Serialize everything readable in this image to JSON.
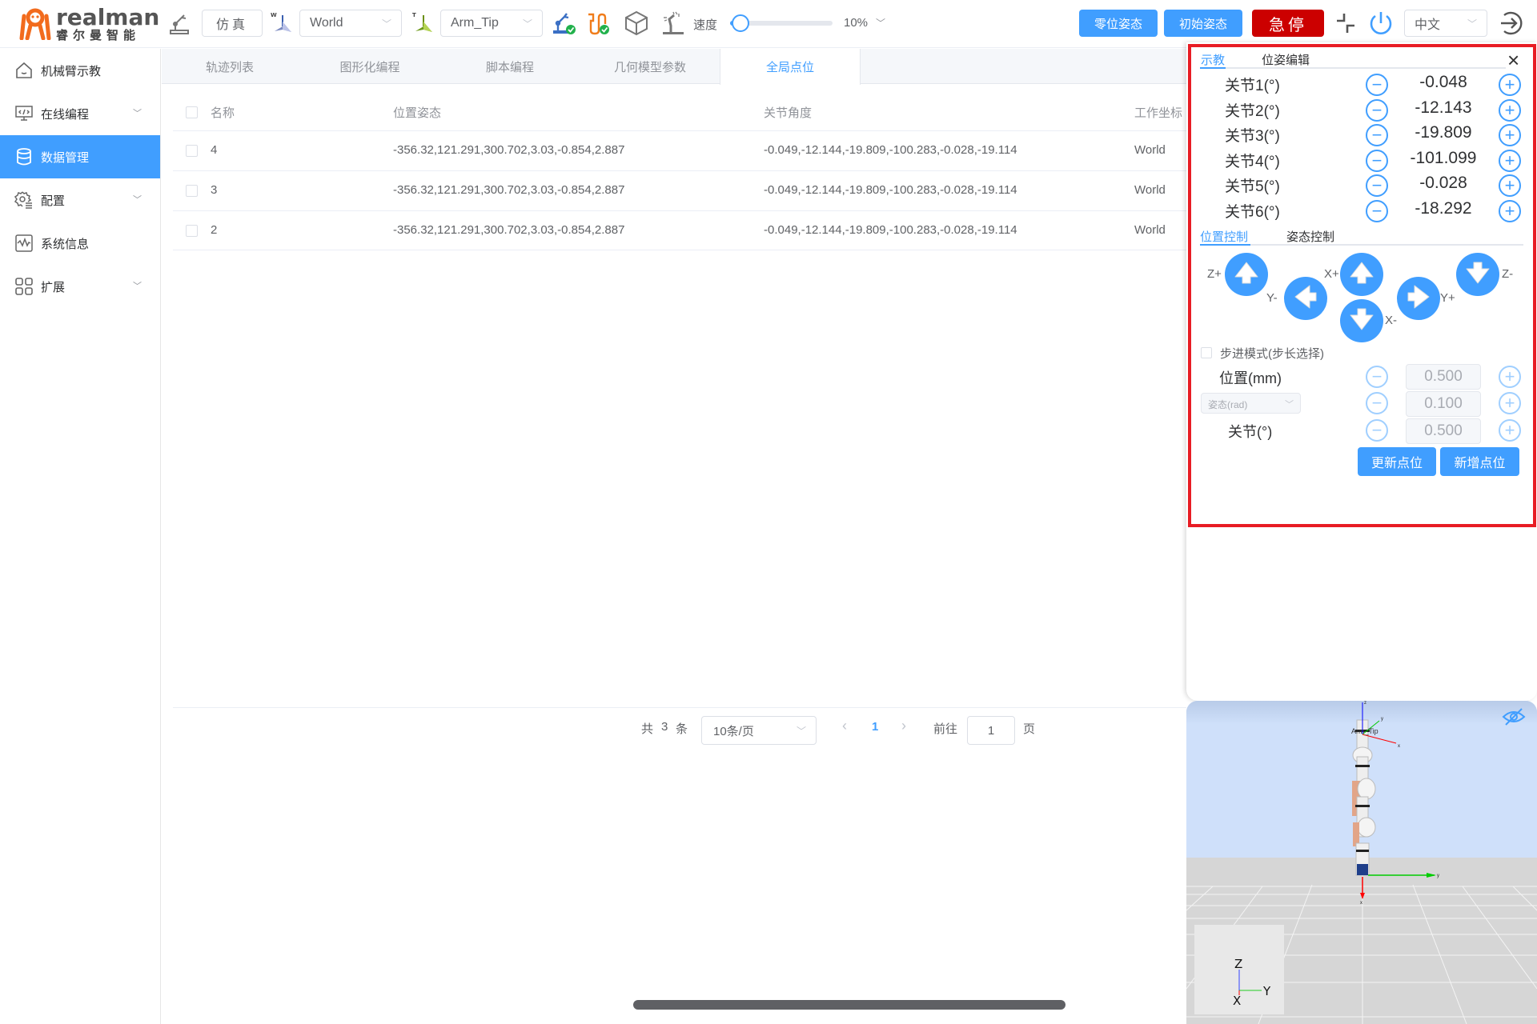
{
  "header": {
    "logo_en": "realman",
    "logo_cn": "睿尔曼智能",
    "mode_button": "仿真",
    "work_frame_prefix": "W",
    "work_frame": "World",
    "tool_frame_prefix": "T",
    "tool_frame": "Arm_Tip",
    "speed_label": "速度",
    "speed_value": "10%",
    "speed_fraction": 0.1,
    "zero_pose_button": "零位姿态",
    "init_pose_button": "初始姿态",
    "estop_button": "急停",
    "language": "中文",
    "colors": {
      "accent": "#409eff",
      "estop": "#cc0000",
      "highlight": "#e81c24"
    }
  },
  "sidebar": {
    "items": [
      {
        "label": "机械臂示教",
        "icon": "home-icon",
        "expandable": false,
        "active": false
      },
      {
        "label": "在线编程",
        "icon": "code-monitor-icon",
        "expandable": true,
        "active": false
      },
      {
        "label": "数据管理",
        "icon": "database-icon",
        "expandable": false,
        "active": true
      },
      {
        "label": "配置",
        "icon": "gear-icon",
        "expandable": true,
        "active": false
      },
      {
        "label": "系统信息",
        "icon": "waveform-icon",
        "expandable": false,
        "active": false
      },
      {
        "label": "扩展",
        "icon": "grid-icon",
        "expandable": true,
        "active": false
      }
    ]
  },
  "tabs": [
    {
      "label": "轨迹列表",
      "active": false
    },
    {
      "label": "图形化编程",
      "active": false
    },
    {
      "label": "脚本编程",
      "active": false
    },
    {
      "label": "几何模型参数",
      "active": false
    },
    {
      "label": "全局点位",
      "active": true
    }
  ],
  "table": {
    "columns": [
      "名称",
      "位置姿态",
      "关节角度",
      "工作坐标"
    ],
    "rows": [
      {
        "name": "4",
        "pose": "-356.32,121.291,300.702,3.03,-0.854,2.887",
        "joints": "-0.049,-12.144,-19.809,-100.283,-0.028,-19.114",
        "frame": "World"
      },
      {
        "name": "3",
        "pose": "-356.32,121.291,300.702,3.03,-0.854,2.887",
        "joints": "-0.049,-12.144,-19.809,-100.283,-0.028,-19.114",
        "frame": "World"
      },
      {
        "name": "2",
        "pose": "-356.32,121.291,300.702,3.03,-0.854,2.887",
        "joints": "-0.049,-12.144,-19.809,-100.283,-0.028,-19.114",
        "frame": "World"
      }
    ]
  },
  "pagination": {
    "total_prefix": "共",
    "total": "3",
    "total_suffix": "条",
    "page_size": "10条/页",
    "prev": "‹",
    "current_page": "1",
    "next": "›",
    "goto_label": "前往",
    "goto_value": "1",
    "goto_suffix": "页"
  },
  "panel": {
    "tabs": [
      {
        "label": "示教",
        "active": true
      },
      {
        "label": "位姿编辑",
        "active": false
      }
    ],
    "close": "×",
    "joints": [
      {
        "label": "关节1(°)",
        "value": "-0.048"
      },
      {
        "label": "关节2(°)",
        "value": "-12.143"
      },
      {
        "label": "关节3(°)",
        "value": "-19.809"
      },
      {
        "label": "关节4(°)",
        "value": "-101.099"
      },
      {
        "label": "关节5(°)",
        "value": "-0.028"
      },
      {
        "label": "关节6(°)",
        "value": "-18.292"
      }
    ],
    "control_tabs": [
      {
        "label": "位置控制",
        "active": true
      },
      {
        "label": "姿态控制",
        "active": false
      }
    ],
    "jog": {
      "z_plus": "Z+",
      "z_minus": "Z-",
      "x_plus": "X+",
      "x_minus": "X-",
      "y_plus": "Y+",
      "y_minus": "Y-"
    },
    "step_mode_label": "步进模式(步长选择)",
    "step_mode_checked": false,
    "steps": [
      {
        "label": "位置(mm)",
        "value": "0.500"
      },
      {
        "label": "姿态(rad)",
        "value": "0.100",
        "is_select": true
      },
      {
        "label": "关节(°)",
        "value": "0.500"
      }
    ],
    "update_button": "更新点位",
    "add_button": "新增点位"
  },
  "viewer": {
    "tool_frame_label": "Arm_Tip",
    "axes": {
      "x": "X",
      "y": "Y",
      "z": "Z"
    },
    "small_axes": {
      "x": "x",
      "y": "y",
      "z": "z"
    }
  }
}
